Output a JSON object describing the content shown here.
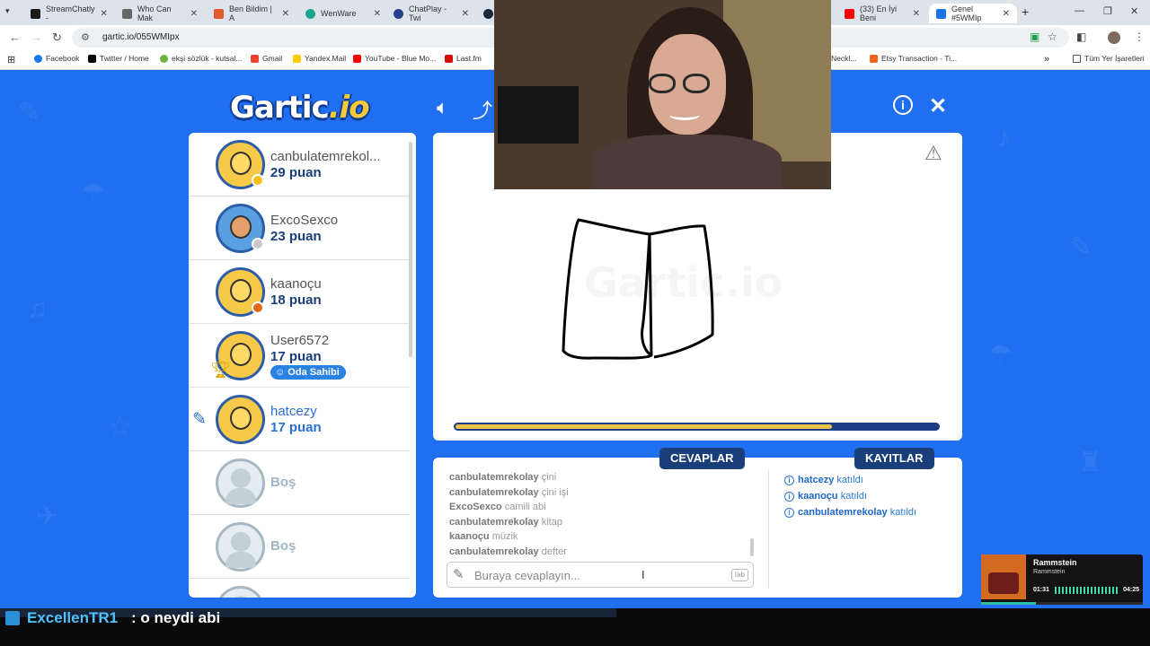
{
  "browser": {
    "tabs": [
      {
        "title": "StreamChatly -",
        "color": "#1a1a1a"
      },
      {
        "title": "Who Can Mak",
        "color": "#666666"
      },
      {
        "title": "Ben Bildim | A",
        "color": "#e05a2b"
      },
      {
        "title": "WenWare",
        "color": "#1ca58a"
      },
      {
        "title": "ChatPlay - Twi",
        "color": "#2a3f8a"
      },
      {
        "title": "(33) En İyi Beni",
        "color": "#ff0000"
      },
      {
        "title": "Genel #5WMIp",
        "color": "#1a73e8"
      }
    ],
    "url": "gartic.io/055WMIpx",
    "bookmarks": [
      {
        "label": "Facebook",
        "color": "#1877f2"
      },
      {
        "label": "Twitter / Home",
        "color": "#000000"
      },
      {
        "label": "ekşi sözlük - kutsal...",
        "color": "#6cb33f"
      },
      {
        "label": "Gmail",
        "color": "#ea4335"
      },
      {
        "label": "Yandex.Mail",
        "color": "#ffcc00"
      },
      {
        "label": "YouTube - Blue Mo...",
        "color": "#ff0000"
      },
      {
        "label": "Last.fm",
        "color": "#d51007"
      },
      {
        "label": "Neckl...",
        "color": "#999999"
      },
      {
        "label": "Etsy Transaction - Ti...",
        "color": "#f1641e"
      }
    ],
    "all_bookmarks": "Tüm Yer İşaretleri"
  },
  "game": {
    "logo_main": "Gartic",
    "logo_suffix": ".io",
    "watermark": "Gartic.io",
    "players": [
      {
        "name": "canbulatemrekol...",
        "points": "29 puan",
        "dot": "#f6c019"
      },
      {
        "name": "ExcoSexco",
        "points": "23 puan",
        "dot": "#c8c8c8"
      },
      {
        "name": "kaanoçu",
        "points": "18 puan",
        "dot": "#e06a14"
      },
      {
        "name": "User6572",
        "points": "17 puan",
        "owner_badge": "Oda Sahibi"
      },
      {
        "name": "hatcezy",
        "points": "17 puan"
      },
      {
        "name": "Boş"
      },
      {
        "name": "Boş"
      }
    ],
    "timer_fraction": 0.78,
    "answers_title": "CEVAPLAR",
    "logs_title": "KAYITLAR",
    "guesses": [
      {
        "user": "canbulatemrekolay",
        "text": "çini"
      },
      {
        "user": "canbulatemrekolay",
        "text": "çini işi"
      },
      {
        "user": "ExcoSexco",
        "text": "camili abi"
      },
      {
        "user": "canbulatemrekolay",
        "text": "kitap"
      },
      {
        "user": "kaanoçu",
        "text": "müzik"
      },
      {
        "user": "canbulatemrekolay",
        "text": "defter"
      }
    ],
    "answer_placeholder": "Buraya cevaplayın...",
    "tab_key": "tab",
    "logs": [
      {
        "user": "hatcezy",
        "text": "katıldı"
      },
      {
        "user": "kaanoçu",
        "text": "katıldı"
      },
      {
        "user": "canbulatemrekolay",
        "text": "katıldı"
      }
    ]
  },
  "music": {
    "title": "Rammstein",
    "artist": "Rammstein",
    "elapsed": "01:31",
    "total": "04:25",
    "progress": 0.34
  },
  "stream_chat": {
    "user": "ExcellenTR1",
    "message": ": o neydi abi"
  }
}
